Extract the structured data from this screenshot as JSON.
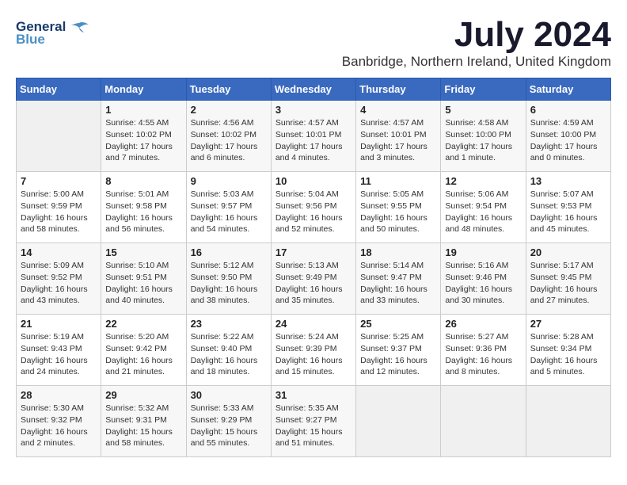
{
  "header": {
    "logo_line1": "General",
    "logo_line2": "Blue",
    "title": "July 2024",
    "subtitle": "Banbridge, Northern Ireland, United Kingdom"
  },
  "calendar": {
    "days_of_week": [
      "Sunday",
      "Monday",
      "Tuesday",
      "Wednesday",
      "Thursday",
      "Friday",
      "Saturday"
    ],
    "weeks": [
      [
        {
          "day": "",
          "info": ""
        },
        {
          "day": "1",
          "info": "Sunrise: 4:55 AM\nSunset: 10:02 PM\nDaylight: 17 hours\nand 7 minutes."
        },
        {
          "day": "2",
          "info": "Sunrise: 4:56 AM\nSunset: 10:02 PM\nDaylight: 17 hours\nand 6 minutes."
        },
        {
          "day": "3",
          "info": "Sunrise: 4:57 AM\nSunset: 10:01 PM\nDaylight: 17 hours\nand 4 minutes."
        },
        {
          "day": "4",
          "info": "Sunrise: 4:57 AM\nSunset: 10:01 PM\nDaylight: 17 hours\nand 3 minutes."
        },
        {
          "day": "5",
          "info": "Sunrise: 4:58 AM\nSunset: 10:00 PM\nDaylight: 17 hours\nand 1 minute."
        },
        {
          "day": "6",
          "info": "Sunrise: 4:59 AM\nSunset: 10:00 PM\nDaylight: 17 hours\nand 0 minutes."
        }
      ],
      [
        {
          "day": "7",
          "info": "Sunrise: 5:00 AM\nSunset: 9:59 PM\nDaylight: 16 hours\nand 58 minutes."
        },
        {
          "day": "8",
          "info": "Sunrise: 5:01 AM\nSunset: 9:58 PM\nDaylight: 16 hours\nand 56 minutes."
        },
        {
          "day": "9",
          "info": "Sunrise: 5:03 AM\nSunset: 9:57 PM\nDaylight: 16 hours\nand 54 minutes."
        },
        {
          "day": "10",
          "info": "Sunrise: 5:04 AM\nSunset: 9:56 PM\nDaylight: 16 hours\nand 52 minutes."
        },
        {
          "day": "11",
          "info": "Sunrise: 5:05 AM\nSunset: 9:55 PM\nDaylight: 16 hours\nand 50 minutes."
        },
        {
          "day": "12",
          "info": "Sunrise: 5:06 AM\nSunset: 9:54 PM\nDaylight: 16 hours\nand 48 minutes."
        },
        {
          "day": "13",
          "info": "Sunrise: 5:07 AM\nSunset: 9:53 PM\nDaylight: 16 hours\nand 45 minutes."
        }
      ],
      [
        {
          "day": "14",
          "info": "Sunrise: 5:09 AM\nSunset: 9:52 PM\nDaylight: 16 hours\nand 43 minutes."
        },
        {
          "day": "15",
          "info": "Sunrise: 5:10 AM\nSunset: 9:51 PM\nDaylight: 16 hours\nand 40 minutes."
        },
        {
          "day": "16",
          "info": "Sunrise: 5:12 AM\nSunset: 9:50 PM\nDaylight: 16 hours\nand 38 minutes."
        },
        {
          "day": "17",
          "info": "Sunrise: 5:13 AM\nSunset: 9:49 PM\nDaylight: 16 hours\nand 35 minutes."
        },
        {
          "day": "18",
          "info": "Sunrise: 5:14 AM\nSunset: 9:47 PM\nDaylight: 16 hours\nand 33 minutes."
        },
        {
          "day": "19",
          "info": "Sunrise: 5:16 AM\nSunset: 9:46 PM\nDaylight: 16 hours\nand 30 minutes."
        },
        {
          "day": "20",
          "info": "Sunrise: 5:17 AM\nSunset: 9:45 PM\nDaylight: 16 hours\nand 27 minutes."
        }
      ],
      [
        {
          "day": "21",
          "info": "Sunrise: 5:19 AM\nSunset: 9:43 PM\nDaylight: 16 hours\nand 24 minutes."
        },
        {
          "day": "22",
          "info": "Sunrise: 5:20 AM\nSunset: 9:42 PM\nDaylight: 16 hours\nand 21 minutes."
        },
        {
          "day": "23",
          "info": "Sunrise: 5:22 AM\nSunset: 9:40 PM\nDaylight: 16 hours\nand 18 minutes."
        },
        {
          "day": "24",
          "info": "Sunrise: 5:24 AM\nSunset: 9:39 PM\nDaylight: 16 hours\nand 15 minutes."
        },
        {
          "day": "25",
          "info": "Sunrise: 5:25 AM\nSunset: 9:37 PM\nDaylight: 16 hours\nand 12 minutes."
        },
        {
          "day": "26",
          "info": "Sunrise: 5:27 AM\nSunset: 9:36 PM\nDaylight: 16 hours\nand 8 minutes."
        },
        {
          "day": "27",
          "info": "Sunrise: 5:28 AM\nSunset: 9:34 PM\nDaylight: 16 hours\nand 5 minutes."
        }
      ],
      [
        {
          "day": "28",
          "info": "Sunrise: 5:30 AM\nSunset: 9:32 PM\nDaylight: 16 hours\nand 2 minutes."
        },
        {
          "day": "29",
          "info": "Sunrise: 5:32 AM\nSunset: 9:31 PM\nDaylight: 15 hours\nand 58 minutes."
        },
        {
          "day": "30",
          "info": "Sunrise: 5:33 AM\nSunset: 9:29 PM\nDaylight: 15 hours\nand 55 minutes."
        },
        {
          "day": "31",
          "info": "Sunrise: 5:35 AM\nSunset: 9:27 PM\nDaylight: 15 hours\nand 51 minutes."
        },
        {
          "day": "",
          "info": ""
        },
        {
          "day": "",
          "info": ""
        },
        {
          "day": "",
          "info": ""
        }
      ]
    ]
  }
}
